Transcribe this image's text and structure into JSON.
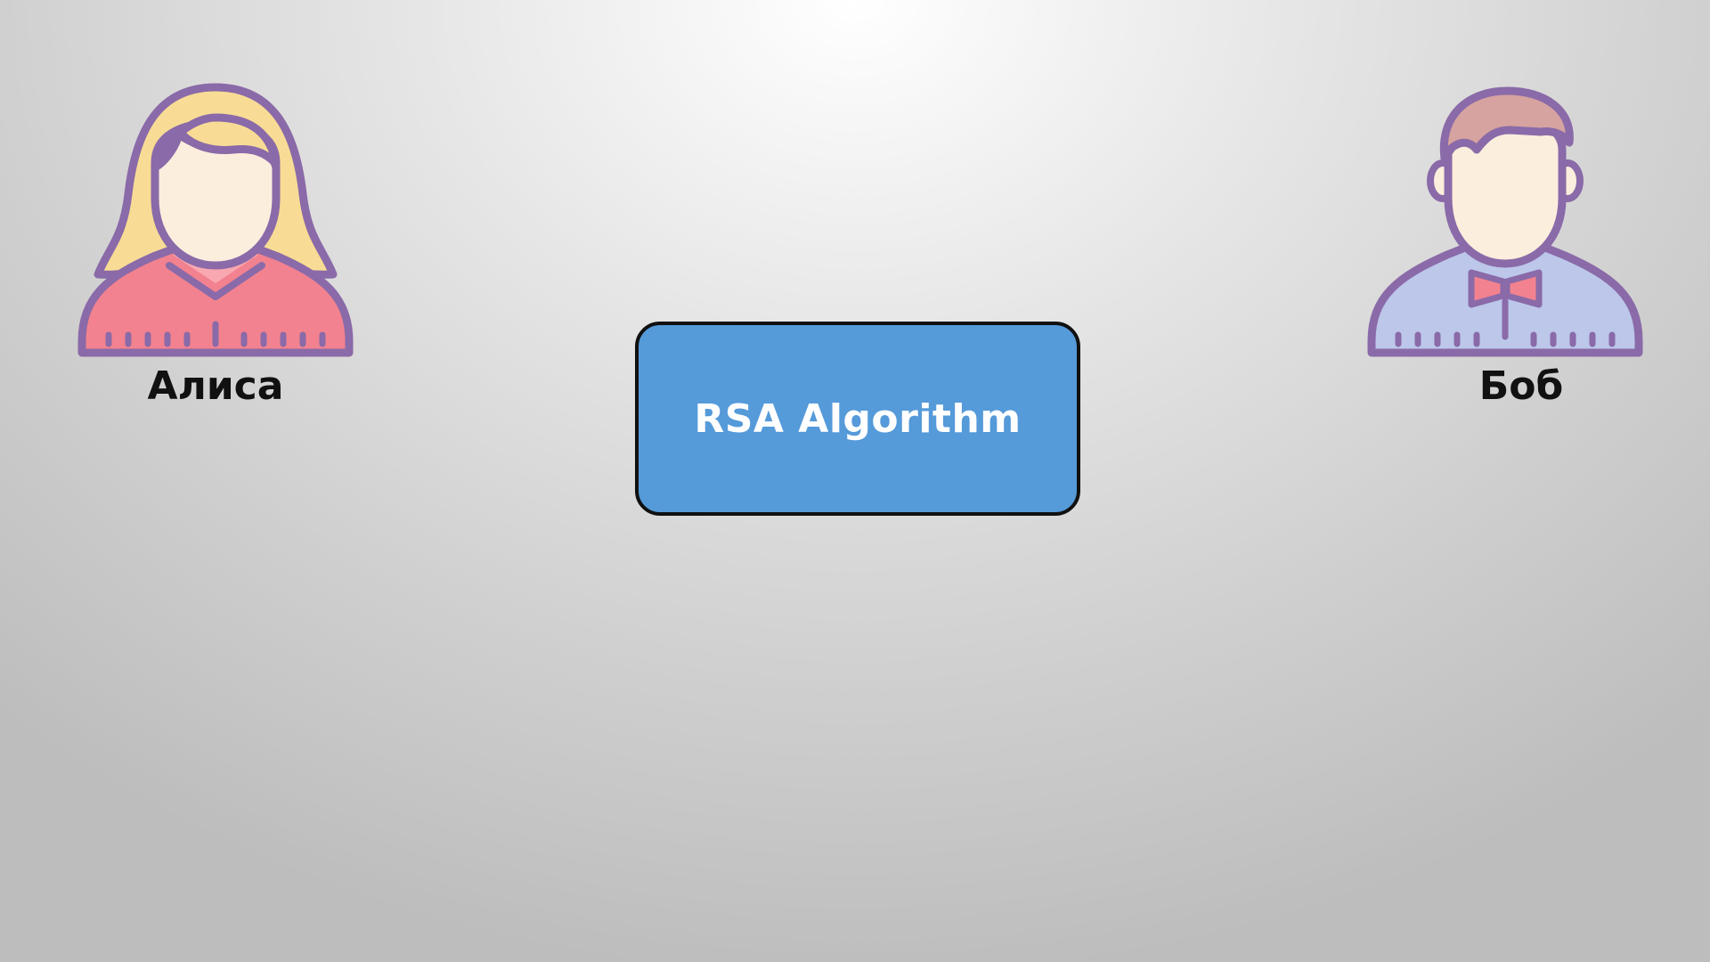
{
  "diagram": {
    "alice": {
      "name": "Алиса",
      "icon": "woman-avatar-icon"
    },
    "bob": {
      "name": "Боб",
      "icon": "man-avatar-icon"
    },
    "center_box": {
      "label": "RSA Algorithm",
      "color": "#559ad9"
    }
  },
  "colors": {
    "outline": "#8a6aa8",
    "skin": "#fbeedd",
    "alice_hair": "#f8dc95",
    "alice_shirt": "#f2828f",
    "bob_hair": "#d7a3a0",
    "bob_shirt": "#bcc7ea",
    "bow_tie": "#f2828f"
  }
}
